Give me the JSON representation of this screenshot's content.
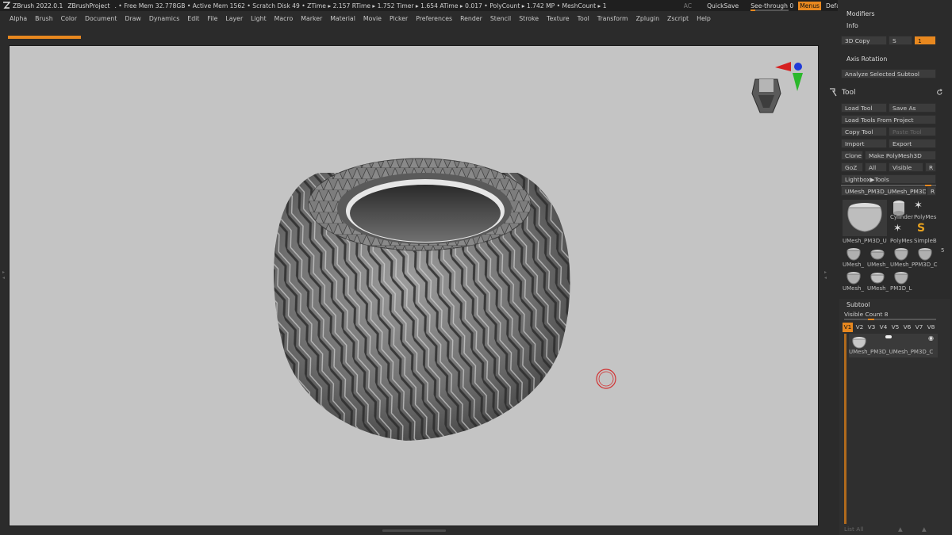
{
  "titlebar": {
    "app": "ZBrush 2022.0.1",
    "project": "ZBrushProject",
    "stats": ". • Free Mem 32.778GB • Active Mem 1562 • Scratch Disk 49 • ZTime ▸ 2.157 RTime ▸ 1.752 Timer ▸ 1.654 ATime ▸ 0.017 • PolyCount ▸ 1.742 MP • MeshCount ▸ 1",
    "ac": "AC",
    "quicksave": "QuickSave",
    "see_through": "See-through  0",
    "menus": "Menus",
    "script": "DefaultZScript",
    "minimize": "–",
    "maximize": "▭",
    "close": "✕"
  },
  "menubar": {
    "items": [
      "Alpha",
      "Brush",
      "Color",
      "Document",
      "Draw",
      "Dynamics",
      "Edit",
      "File",
      "Layer",
      "Light",
      "Macro",
      "Marker",
      "Material",
      "Movie",
      "Picker",
      "Preferences",
      "Render",
      "Stencil",
      "Stroke",
      "Texture",
      "Tool",
      "Transform",
      "Zplugin",
      "Zscript",
      "Help"
    ]
  },
  "progress": {
    "fraction": 0.09
  },
  "panel": {
    "modifiers": "Modifiers",
    "info": "Info",
    "copy3d": "3D Copy",
    "s_label": "S",
    "s_value": "1",
    "axis_rotation": "Axis Rotation",
    "analyze": "Analyze Selected Subtool",
    "tool_title": "Tool",
    "load_tool": "Load Tool",
    "save_as": "Save As",
    "load_from_project": "Load Tools From Project",
    "copy_tool": "Copy Tool",
    "paste_tool": "Paste Tool",
    "import": "Import",
    "export": "Export",
    "clone": "Clone",
    "make_polymesh": "Make PolyMesh3D",
    "goz": "GoZ",
    "all": "All",
    "visible": "Visible",
    "r": "R",
    "lightbox_tools": "Lightbox▶Tools",
    "current_tool": "UMesh_PM3D_UMesh_PM3D",
    "current_tool_r": "R",
    "thumb_main_label": "UMesh_PM3D_U",
    "thumb_cylinder": "Cylinder",
    "thumb_polymesh": "PolyMes",
    "thumb_polymesh2": "PolyMes",
    "thumb_simpleb": "SimpleB",
    "thumb_extra": "5",
    "thumb_row2": [
      "UMesh_",
      "UMesh_",
      "UMesh_P",
      "PM3D_C"
    ],
    "thumb_row3": [
      "UMesh_",
      "UMesh_",
      "PM3D_L"
    ],
    "subtool": "Subtool",
    "visible_count": "Visible Count 8",
    "versions": [
      "V1",
      "V2",
      "V3",
      "V4",
      "V5",
      "V6",
      "V7",
      "V8"
    ],
    "subtool_item": "UMesh_PM3D_UMesh_PM3D_C",
    "list_all": "List All"
  },
  "colors": {
    "accent": "#e8881f",
    "viewport_bg": "#c4c4c4",
    "ui_bg": "#2b2b2b"
  }
}
